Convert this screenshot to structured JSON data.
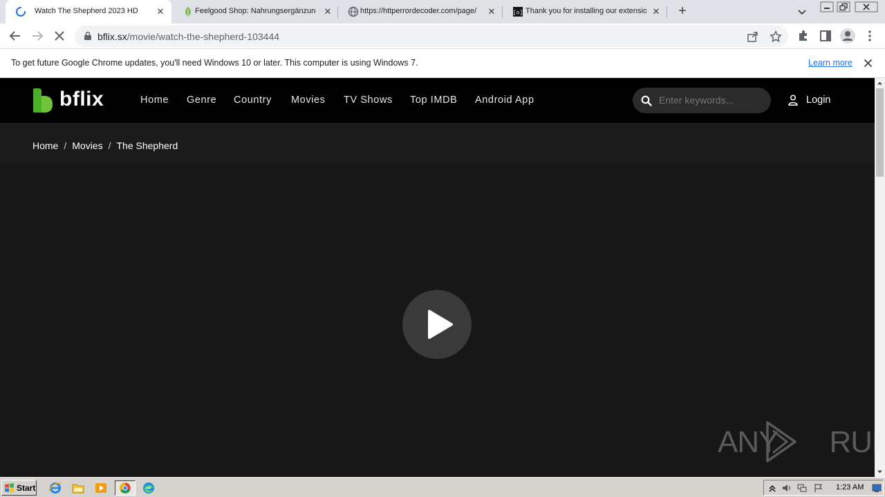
{
  "browser": {
    "tabs": [
      {
        "title": "Watch The Shepherd 2023 HD",
        "active": true,
        "favicon": "loading-spinner-icon"
      },
      {
        "title": "Feelgood Shop: Nahrungsergänzung",
        "active": false,
        "favicon": "leaf-icon"
      },
      {
        "title": "https://httperrordecoder.com/page/",
        "active": false,
        "favicon": "globe-icon"
      },
      {
        "title": "Thank you for installing our extensio",
        "active": false,
        "favicon": "extension-site-icon"
      }
    ],
    "url": {
      "host": "bflix.sx",
      "path": "/movie/watch-the-shepherd-103444"
    },
    "infobar": {
      "message": "To get future Google Chrome updates, you'll need Windows 10 or later. This computer is using Windows 7.",
      "link": "Learn more"
    }
  },
  "site": {
    "logo_text": "bflix",
    "nav": [
      "Home",
      "Genre",
      "Country",
      "Movies",
      "TV Shows",
      "Top IMDB",
      "Android App"
    ],
    "search_placeholder": "Enter keywords...",
    "login": "Login",
    "breadcrumb": [
      "Home",
      "Movies",
      "The Shepherd"
    ]
  },
  "watermark": "ANY RUN",
  "taskbar": {
    "start_label": "Start",
    "apps": [
      "internet-explorer-icon",
      "file-explorer-icon",
      "media-player-icon",
      "chrome-icon",
      "edge-icon"
    ],
    "clock": "1:23 AM"
  },
  "colors": {
    "brand_green": "#4caf2a",
    "page_bg": "#1b1b1b",
    "header_bg": "#000000",
    "chrome_tabstrip": "#dee1e6",
    "link_blue": "#1a73e8"
  }
}
